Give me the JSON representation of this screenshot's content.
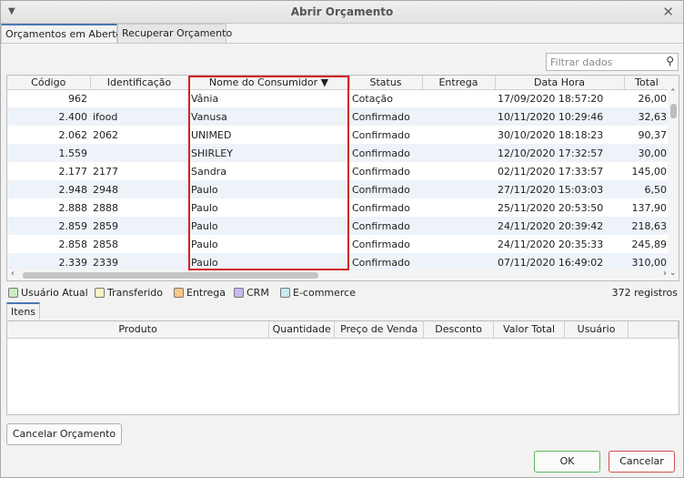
{
  "window": {
    "title": "Abrir Orçamento"
  },
  "tabs": [
    {
      "label": "Orçamentos em Aberto",
      "active": true
    },
    {
      "label": "Recuperar Orçamento",
      "active": false
    }
  ],
  "filter": {
    "placeholder": "Filtrar dados",
    "value": ""
  },
  "grid": {
    "columns": [
      "Código",
      "Identificação",
      "Nome do Consumidor ▼",
      "Status",
      "Entrega",
      "Data Hora",
      "Total"
    ],
    "sorted_column": "Nome do Consumidor",
    "rows": [
      {
        "codigo": "962",
        "identificacao": "",
        "nome": "Vânia",
        "status": "Cotação",
        "entrega": "",
        "data_hora": "17/09/2020 18:57:20",
        "total": "26,00"
      },
      {
        "codigo": "2.400",
        "identificacao": "ifood",
        "nome": "Vanusa",
        "status": "Confirmado",
        "entrega": "",
        "data_hora": "10/11/2020 10:29:46",
        "total": "32,63"
      },
      {
        "codigo": "2.062",
        "identificacao": "2062",
        "nome": "UNIMED",
        "status": "Confirmado",
        "entrega": "",
        "data_hora": "30/10/2020 18:18:23",
        "total": "90,37"
      },
      {
        "codigo": "1.559",
        "identificacao": "",
        "nome": "SHIRLEY",
        "status": "Confirmado",
        "entrega": "",
        "data_hora": "12/10/2020 17:32:57",
        "total": "30,00"
      },
      {
        "codigo": "2.177",
        "identificacao": "2177",
        "nome": "Sandra",
        "status": "Confirmado",
        "entrega": "",
        "data_hora": "02/11/2020 17:33:57",
        "total": "145,00"
      },
      {
        "codigo": "2.948",
        "identificacao": "2948",
        "nome": "Paulo",
        "status": "Confirmado",
        "entrega": "",
        "data_hora": "27/11/2020 15:03:03",
        "total": "6,50"
      },
      {
        "codigo": "2.888",
        "identificacao": "2888",
        "nome": "Paulo",
        "status": "Confirmado",
        "entrega": "",
        "data_hora": "25/11/2020 20:53:50",
        "total": "137,90"
      },
      {
        "codigo": "2.859",
        "identificacao": "2859",
        "nome": "Paulo",
        "status": "Confirmado",
        "entrega": "",
        "data_hora": "24/11/2020 20:39:42",
        "total": "218,63"
      },
      {
        "codigo": "2.858",
        "identificacao": "2858",
        "nome": "Paulo",
        "status": "Confirmado",
        "entrega": "",
        "data_hora": "24/11/2020 20:35:33",
        "total": "245,89"
      },
      {
        "codigo": "2.339",
        "identificacao": "2339",
        "nome": "Paulo",
        "status": "Confirmado",
        "entrega": "",
        "data_hora": "07/11/2020 16:49:02",
        "total": "310,00"
      }
    ]
  },
  "legend": {
    "items": [
      {
        "label": "Usuário Atual",
        "color": "#c8ecc0"
      },
      {
        "label": "Transferido",
        "color": "#fff3c4"
      },
      {
        "label": "Entrega",
        "color": "#f9c88a"
      },
      {
        "label": "CRM",
        "color": "#c9b8f2"
      },
      {
        "label": "E-commerce",
        "color": "#c4ecf2"
      }
    ],
    "count": "372 registros"
  },
  "itens": {
    "tab_label": "Itens",
    "columns": [
      "Produto",
      "Quantidade",
      "Preço de Venda",
      "Desconto",
      "Valor Total",
      "Usuário"
    ]
  },
  "buttons": {
    "cancel_budget": "Cancelar Orçamento",
    "ok": "OK",
    "cancel": "Cancelar"
  },
  "colors": {
    "highlight": "#d42020",
    "ok_border": "#5cb85c",
    "cancel_border": "#d05050",
    "tab_accent": "#4a78b5"
  }
}
